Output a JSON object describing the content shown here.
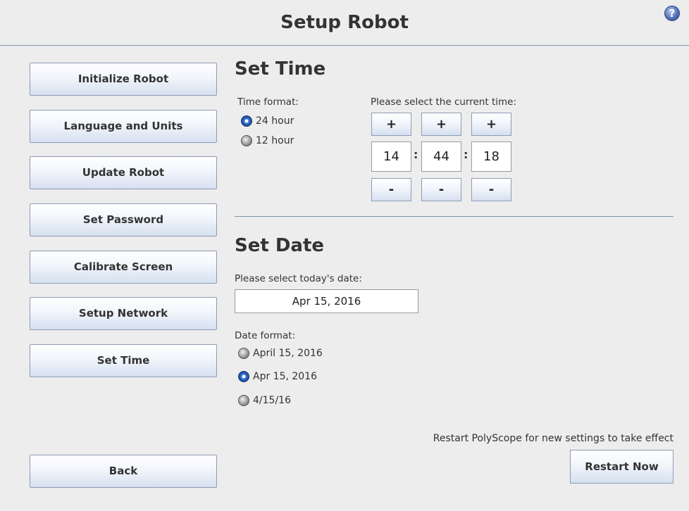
{
  "header": {
    "title": "Setup Robot",
    "help_glyph": "?",
    "help_icon": "question-mark-circle-icon"
  },
  "sidebar": {
    "items": [
      {
        "label": "Initialize Robot"
      },
      {
        "label": "Language and Units"
      },
      {
        "label": "Update Robot"
      },
      {
        "label": "Set Password"
      },
      {
        "label": "Calibrate Screen"
      },
      {
        "label": "Setup Network"
      },
      {
        "label": "Set Time"
      }
    ],
    "back_label": "Back"
  },
  "time": {
    "title": "Set Time",
    "format_label": "Time format:",
    "formats": [
      {
        "label": "24 hour",
        "selected": true
      },
      {
        "label": "12 hour",
        "selected": false
      }
    ],
    "select_label": "Please select the current time:",
    "increment_label": "+",
    "decrement_label": "-",
    "separator": ":",
    "hours": "14",
    "minutes": "44",
    "seconds": "18"
  },
  "date": {
    "title": "Set Date",
    "select_label": "Please select today's date:",
    "value": "Apr 15, 2016",
    "format_label": "Date format:",
    "formats": [
      {
        "label": "April 15, 2016",
        "selected": false
      },
      {
        "label": "Apr 15, 2016",
        "selected": true
      },
      {
        "label": "4/15/16",
        "selected": false
      }
    ]
  },
  "footer": {
    "restart_note": "Restart PolyScope for new settings to take effect",
    "restart_label": "Restart Now"
  },
  "colors": {
    "background": "#ededed",
    "divider": "#7f93b3",
    "radio_selected": "#2454a8"
  }
}
